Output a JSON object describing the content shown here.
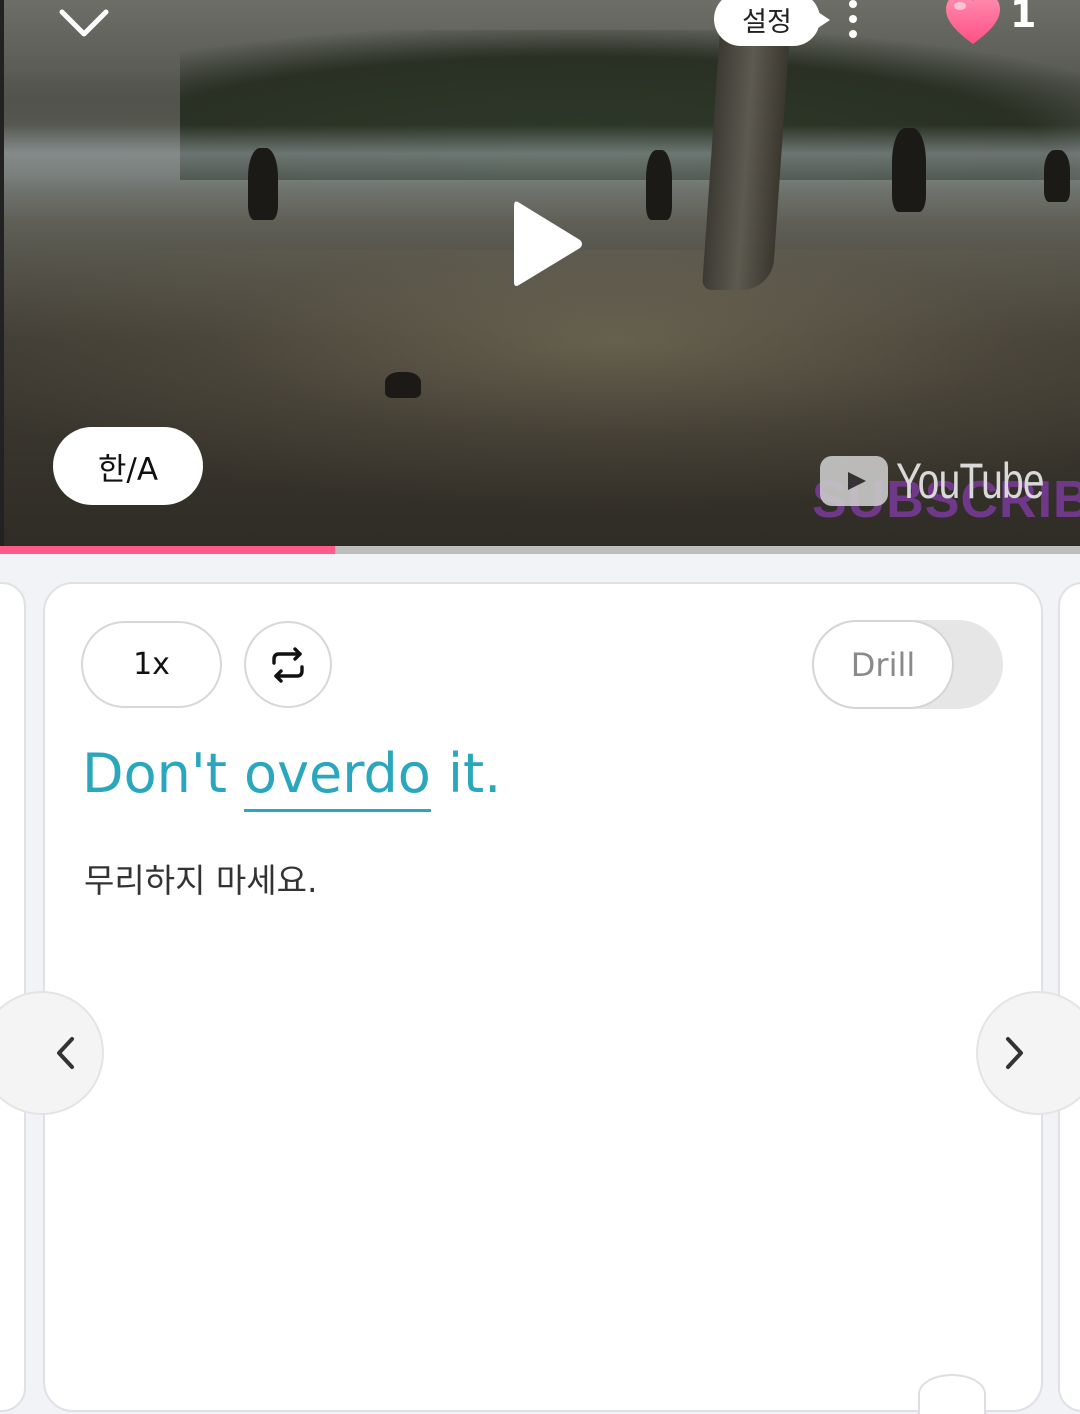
{
  "header": {
    "settings_label": "설정",
    "likes_count": "1",
    "heart_color": "#ff5a8a"
  },
  "player": {
    "language_toggle_label": "한/A",
    "watermark_logo_text": "YouTube",
    "watermark_overlay_text": "SUBSCRIBE",
    "progress_fraction": 0.31,
    "progress_color": "#ff5a8a"
  },
  "card": {
    "speed_label": "1x",
    "drill_label": "Drill",
    "sentence": {
      "before": "Don't ",
      "keyword": "overdo",
      "after": " it.",
      "color": "#2aa7bd"
    },
    "translation": "무리하지 마세요."
  },
  "icons": [
    "chevron-down-icon",
    "kebab-menu-icon",
    "heart-icon",
    "play-icon",
    "repeat-icon",
    "chevron-left-icon",
    "chevron-right-icon"
  ]
}
